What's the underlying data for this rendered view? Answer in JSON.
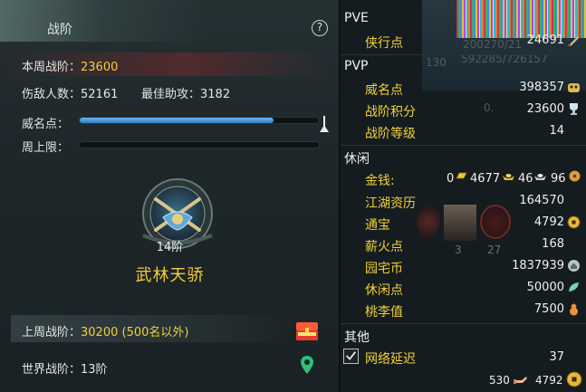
{
  "left": {
    "title": "战阶",
    "help": "?",
    "week_rank_label": "本周战阶：",
    "week_rank_value": "23600",
    "kills_label": "伤敌人数：",
    "kills_value": "52161",
    "assist_label": "最佳助攻：",
    "assist_value": "3182",
    "fame_label": "威名点：",
    "fame_progress": 0.81,
    "weekly_cap_label": "周上限：",
    "weekly_cap_progress": 0.0,
    "rank_level": "14阶",
    "rank_title": "武林天骄",
    "last_week_label": "上周战阶：",
    "last_week_value": "30200 (500名以外)",
    "world_rank_label": "世界战阶：",
    "world_rank_value": "13阶"
  },
  "right": {
    "pve_header": "PVE",
    "pve_items": [
      {
        "label": "侠行点",
        "value": "24691",
        "icon": "blade-icon"
      }
    ],
    "pvp_header": "PVP",
    "pvp_items": [
      {
        "label": "威名点",
        "value": "398357",
        "icon": "tiger-mask-icon"
      },
      {
        "label": "战阶积分",
        "value": "23600",
        "icon": "trophy-icon"
      },
      {
        "label": "战阶等级",
        "value": "14"
      }
    ],
    "leisure_header": "休闲",
    "money_label": "金钱:",
    "money": {
      "gold_ingot": "0",
      "gold": "4677",
      "silver": "46",
      "copper": "96"
    },
    "leisure_items": [
      {
        "label": "江湖资历",
        "value": "164570"
      },
      {
        "label": "通宝",
        "value": "4792",
        "icon": "coin-icon"
      },
      {
        "label": "薪火点",
        "value": "168"
      },
      {
        "label": "园宅币",
        "value": "1837939",
        "icon": "house-coin-icon"
      },
      {
        "label": "休闲点",
        "value": "50000",
        "icon": "leaf-icon"
      },
      {
        "label": "桃李值",
        "value": "7500",
        "icon": "gourd-icon"
      }
    ],
    "other_header": "其他",
    "other_items": [
      {
        "label": "网络延迟",
        "value": "37",
        "checked": true
      }
    ],
    "footer": {
      "left_value": "530",
      "right_value": "4792"
    },
    "background_ghost": [
      "200270/21",
      "592285/726157",
      "130",
      "0.",
      "3",
      "27"
    ]
  },
  "colors": {
    "accent_yellow": "#f2d03a",
    "bar_blue": "#3b8ad4"
  }
}
